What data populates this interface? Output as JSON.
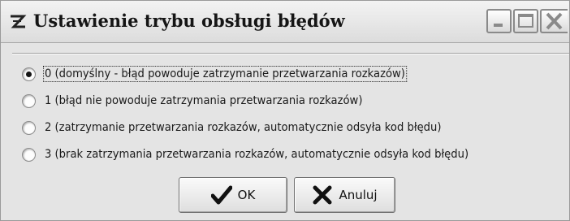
{
  "window": {
    "title": "Ustawienie trybu obsługi błędów",
    "title_icon": "Z-stylized-app-icon",
    "controls": [
      "minimize-icon",
      "maximize-icon",
      "close-icon"
    ]
  },
  "options": [
    {
      "label": "0 (domyślny - błąd powoduje zatrzymanie przetwarzania rozkazów)",
      "selected": true
    },
    {
      "label": "1 (błąd nie powoduje zatrzymania przetwarzania rozkazów)",
      "selected": false
    },
    {
      "label": "2 (zatrzymanie przetwarzania rozkazów, automatycznie odsyła kod błędu)",
      "selected": false
    },
    {
      "label": "3 (brak zatrzymania przetwarzania rozkazów, automatycznie odsyła kod błędu)",
      "selected": false
    }
  ],
  "buttons": {
    "ok_label": "OK",
    "ok_icon": "checkmark-icon",
    "cancel_label": "Anuluj",
    "cancel_icon": "x-cross-icon"
  }
}
